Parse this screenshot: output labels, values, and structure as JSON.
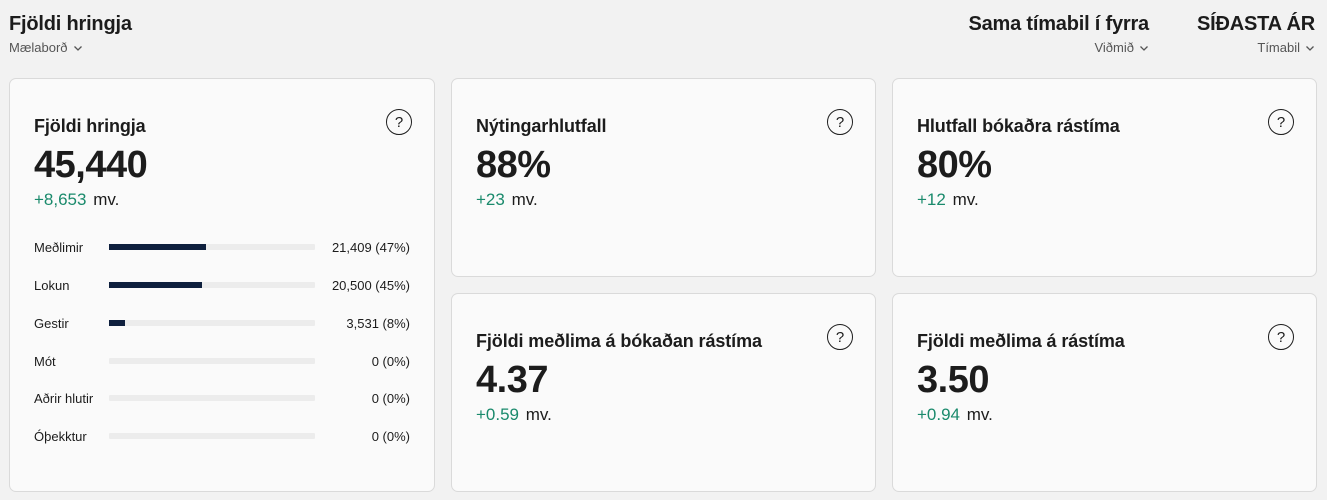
{
  "header": {
    "title": "Fjöldi hringja",
    "dashboard_select": "Mælaborð",
    "compare": {
      "title": "Sama tímabil í fyrra",
      "select": "Viðmið"
    },
    "period": {
      "title": "SÍÐASTA ÁR",
      "select": "Tímabil"
    }
  },
  "icons": {
    "chevron": "chevron-down-icon",
    "help": "question-circle-icon"
  },
  "colors": {
    "positive": "#1a8a6c",
    "bar": "#0e1f3d",
    "track": "#ececec"
  },
  "cards": {
    "rounds": {
      "title": "Fjöldi hringja",
      "value": "45,440",
      "delta": "+8,653",
      "delta_unit": "mv.",
      "breakdown": [
        {
          "label": "Meðlimir",
          "value": "21,409 (47%)",
          "fraction": 0.47
        },
        {
          "label": "Lokun",
          "value": "20,500 (45%)",
          "fraction": 0.45
        },
        {
          "label": "Gestir",
          "value": "3,531 (8%)",
          "fraction": 0.08
        },
        {
          "label": "Mót",
          "value": "0 (0%)",
          "fraction": 0
        },
        {
          "label": "Aðrir hlutir",
          "value": "0 (0%)",
          "fraction": 0
        },
        {
          "label": "Óþekktur",
          "value": "0 (0%)",
          "fraction": 0
        }
      ]
    },
    "utilization": {
      "title": "Nýtingarhlutfall",
      "value": "88%",
      "delta": "+23",
      "delta_unit": "mv."
    },
    "booked_ratio": {
      "title": "Hlutfall bókaðra rástíma",
      "value": "80%",
      "delta": "+12",
      "delta_unit": "mv."
    },
    "members_booked": {
      "title": "Fjöldi meðlima á bókaðan rástíma",
      "value": "4.37",
      "delta": "+0.59",
      "delta_unit": "mv."
    },
    "members_teetime": {
      "title": "Fjöldi meðlima á rástíma",
      "value": "3.50",
      "delta": "+0.94",
      "delta_unit": "mv."
    }
  }
}
